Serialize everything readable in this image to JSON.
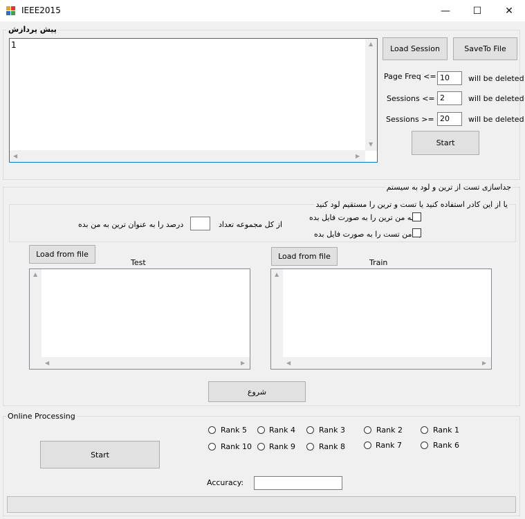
{
  "window": {
    "title": "IEEE2015",
    "minimize": "—",
    "maximize": "☐",
    "close": "✕"
  },
  "preprocess": {
    "group_label": "پیش پردازش",
    "log_text": "1",
    "load_session": "Load Session",
    "save_to_file": "SaveTo File",
    "page_freq_label": "Page Freq <= :",
    "page_freq_value": "10",
    "sessions_le_label": "Sessions <= :",
    "sessions_le_value": "2",
    "sessions_ge_label": "Sessions >= :",
    "sessions_ge_value": "20",
    "deleted_suffix": "will be deleted",
    "start": "Start"
  },
  "split": {
    "group_label": "جداسازی تست از ترین و لود به سیستم",
    "inner_label": "یا از این کادر استفاده کنید یا تست و ترین را مستقیم لود کنید",
    "from_total": "از کل مجموعه تعداد",
    "percent_as_train": "درصد را به عنوان ترین به من بده",
    "percent_value": "",
    "give_train_file": "به من ترین را  به صورت فایل بده",
    "give_test_file": "به من تست را به صورت فایل بده",
    "load_test": "Load from file",
    "load_train": "Load from file",
    "test_label": "Test",
    "train_label": "Train",
    "start": "شروع"
  },
  "online": {
    "group_label": "Online Processing",
    "start": "Start",
    "ranks": [
      "Rank 5",
      "Rank 4",
      "Rank 3",
      "Rank 2",
      "Rank 1",
      "Rank 10",
      "Rank 9",
      "Rank 8",
      "Rank 7",
      "Rank 6"
    ],
    "accuracy_label": "Accuracy:",
    "accuracy_value": ""
  },
  "progress": {
    "value": 0
  }
}
